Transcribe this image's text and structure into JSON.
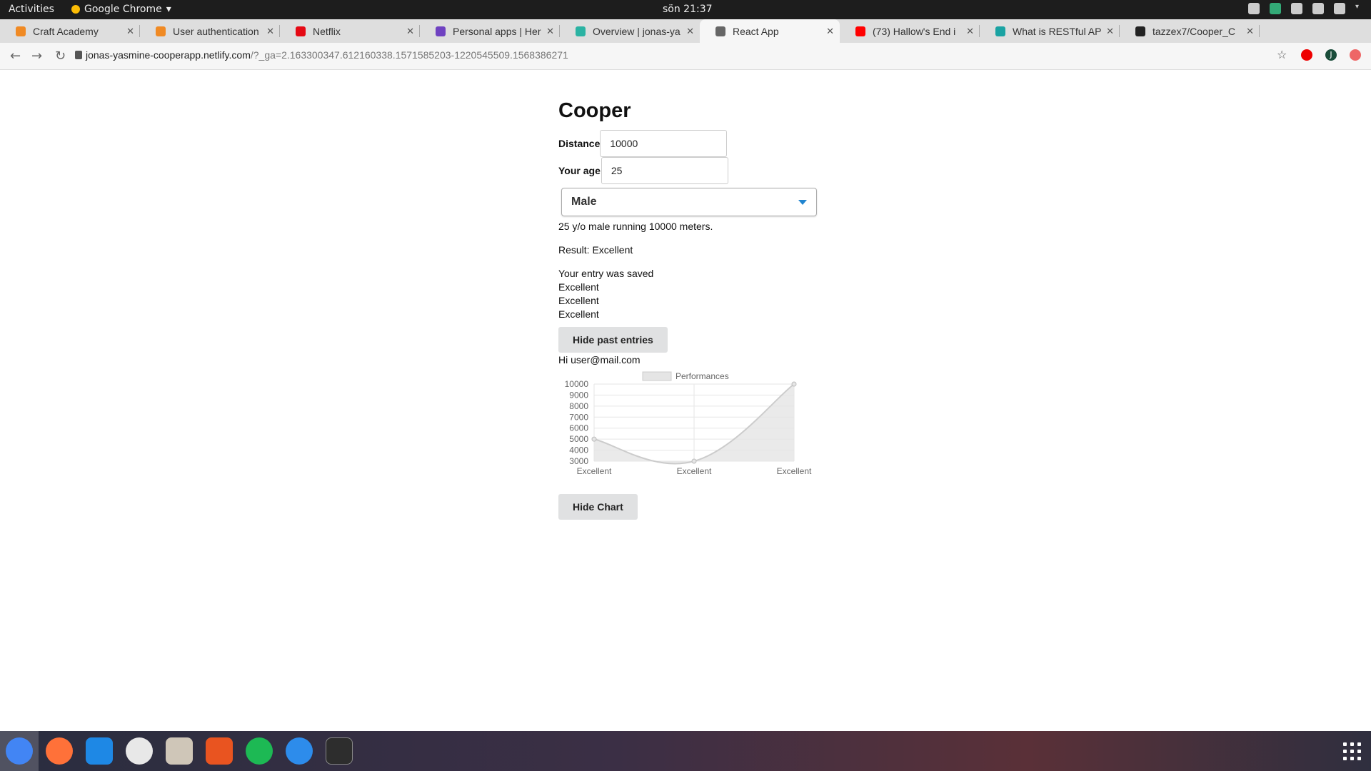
{
  "system": {
    "activities": "Activities",
    "app_name": "Google Chrome",
    "clock": "sön 21:37"
  },
  "browser": {
    "tabs": [
      {
        "title": "Craft Academy",
        "color": "#f08a24"
      },
      {
        "title": "User authentication",
        "color": "#f08a24"
      },
      {
        "title": "Netflix",
        "color": "#e50914"
      },
      {
        "title": "Personal apps | Her",
        "color": "#6f42c1"
      },
      {
        "title": "Overview | jonas-ya",
        "color": "#2bb3a3"
      },
      {
        "title": "React App",
        "color": "#666666"
      },
      {
        "title": "(73) Hallow's End i",
        "color": "#ff0000"
      },
      {
        "title": "What is RESTful AP",
        "color": "#1aa3a3"
      },
      {
        "title": "tazzex7/Cooper_C",
        "color": "#222222"
      }
    ],
    "url_host": "jonas-yasmine-cooperapp.netlify.com",
    "url_rest": "/?_ga=2.163300347.612160338.1571585203-1220545509.1568386271",
    "profile_letter": "J"
  },
  "page": {
    "title": "Cooper",
    "distance_label": "Distance",
    "distance_value": "10000",
    "age_label": "Your age",
    "age_value": "25",
    "gender_selected": "Male",
    "summary": "25 y/o male running 10000 meters.",
    "result": "Result: Excellent",
    "saved_message": "Your entry was saved",
    "entries": [
      "Excellent",
      "Excellent",
      "Excellent"
    ],
    "hide_entries_button": "Hide past entries",
    "greeting": "Hi user@mail.com",
    "hide_chart_button": "Hide Chart"
  },
  "chart_data": {
    "type": "line",
    "categories": [
      "Excellent",
      "Excellent",
      "Excellent"
    ],
    "series": [
      {
        "name": "Performances",
        "values": [
          5000,
          3000,
          10000
        ]
      }
    ],
    "ylim": [
      3000,
      10000
    ],
    "yticks": [
      10000,
      9000,
      8000,
      7000,
      6000,
      5000,
      4000,
      3000
    ],
    "legend": "top",
    "grid": true,
    "fill": "#e5e5e5",
    "line": "#cccccc"
  }
}
